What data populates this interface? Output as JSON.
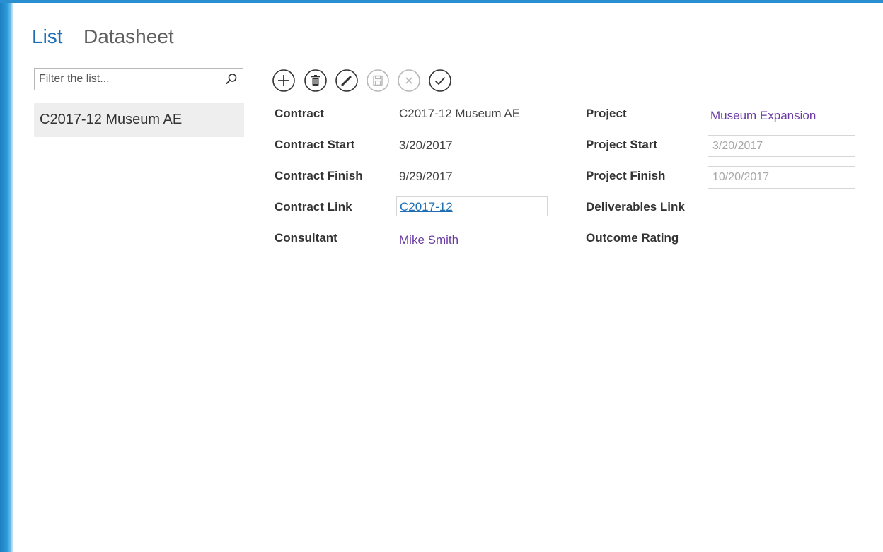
{
  "tabs": [
    {
      "label": "List"
    },
    {
      "label": "Datasheet"
    }
  ],
  "filter": {
    "placeholder": "Filter the list..."
  },
  "list": {
    "items": [
      {
        "label": "C2017-12 Museum AE"
      }
    ]
  },
  "toolbar": {
    "actions": [
      "add",
      "delete",
      "edit",
      "save",
      "cancel",
      "accept"
    ]
  },
  "record": {
    "contract": {
      "label": "Contract",
      "value": "C2017-12 Museum AE"
    },
    "contract_start": {
      "label": "Contract Start",
      "value": "3/20/2017"
    },
    "contract_finish": {
      "label": "Contract Finish",
      "value": "9/29/2017"
    },
    "contract_link": {
      "label": "Contract Link",
      "value": "C2017-12"
    },
    "consultant": {
      "label": "Consultant",
      "value": "Mike Smith"
    },
    "project": {
      "label": "Project",
      "value": "Museum Expansion"
    },
    "project_start": {
      "label": "Project Start",
      "value": "3/20/2017"
    },
    "project_finish": {
      "label": "Project Finish",
      "value": "10/20/2017"
    },
    "deliverables_link": {
      "label": "Deliverables Link"
    },
    "outcome_rating": {
      "label": "Outcome Rating"
    }
  },
  "colors": {
    "accent": "#1f6fb5",
    "person_link": "#6a3aa3",
    "left_bar": "#2b9ad8"
  }
}
